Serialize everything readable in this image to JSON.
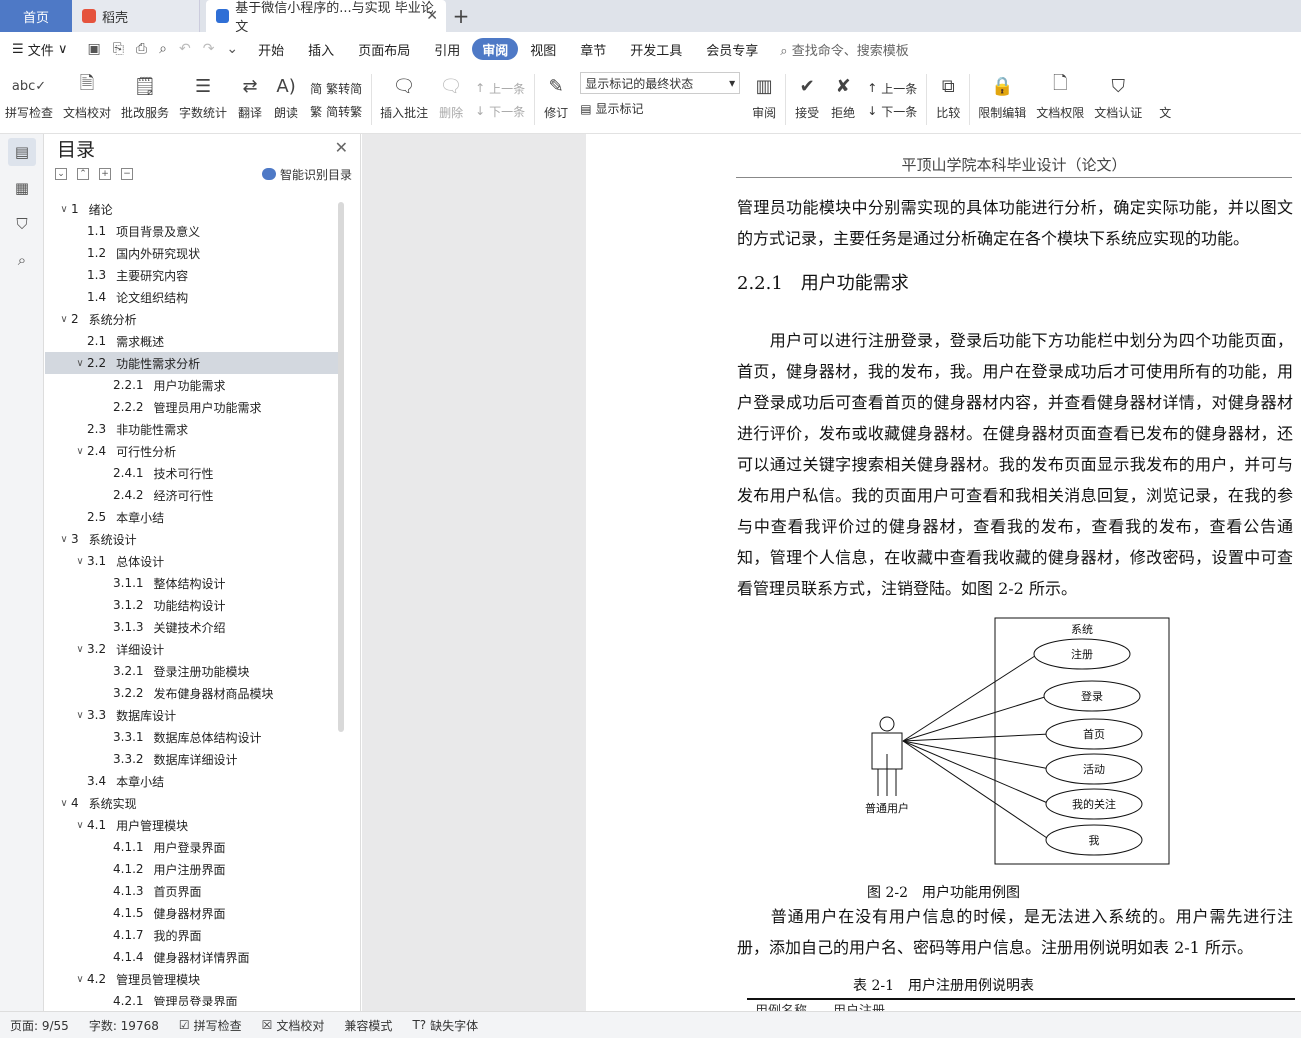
{
  "tabs": {
    "home": "首页",
    "daoke": "稻壳",
    "doc": "基于微信小程序的...与实现 毕业论文"
  },
  "menu": {
    "file": "文件",
    "items": [
      "开始",
      "插入",
      "页面布局",
      "引用",
      "审阅",
      "视图",
      "章节",
      "开发工具",
      "会员专享"
    ],
    "active": "审阅",
    "search": "查找命令、搜索模板"
  },
  "ribbon": {
    "spell": "拼写检查",
    "proof": "文档校对",
    "batch": "批改服务",
    "wordcount": "字数统计",
    "translate": "翻译",
    "read": "朗读",
    "trad": "繁转简",
    "simp": "简转繁",
    "insert_comment": "插入批注",
    "delete": "删除",
    "prev_comment": "上一条",
    "next_comment": "下一条",
    "revise": "修订",
    "markup_select": "显示标记的最终状态",
    "show_markup": "显示标记",
    "review": "审阅",
    "accept": "接受",
    "reject": "拒绝",
    "prev": "上一条",
    "next": "下一条",
    "compare": "比较",
    "restrict": "限制编辑",
    "permission": "文档权限",
    "certify": "文档认证",
    "more": "文"
  },
  "toc": {
    "title": "目录",
    "smart": "智能识别目录",
    "items": [
      {
        "level": 1,
        "num": "1",
        "text": "绪论",
        "chev": "∨"
      },
      {
        "level": 2,
        "num": "1.1",
        "text": "项目背景及意义",
        "chev": ""
      },
      {
        "level": 2,
        "num": "1.2",
        "text": "国内外研究现状",
        "chev": ""
      },
      {
        "level": 2,
        "num": "1.3",
        "text": "主要研究内容",
        "chev": ""
      },
      {
        "level": 2,
        "num": "1.4",
        "text": "论文组织结构",
        "chev": ""
      },
      {
        "level": 1,
        "num": "2",
        "text": "系统分析",
        "chev": "∨"
      },
      {
        "level": 2,
        "num": "2.1",
        "text": "需求概述",
        "chev": ""
      },
      {
        "level": 2,
        "num": "2.2",
        "text": "功能性需求分析",
        "chev": "∨",
        "sel": true
      },
      {
        "level": 3,
        "num": "2.2.1",
        "text": "用户功能需求",
        "chev": ""
      },
      {
        "level": 3,
        "num": "2.2.2",
        "text": "管理员用户功能需求",
        "chev": ""
      },
      {
        "level": 2,
        "num": "2.3",
        "text": "非功能性需求",
        "chev": ""
      },
      {
        "level": 2,
        "num": "2.4",
        "text": "可行性分析",
        "chev": "∨"
      },
      {
        "level": 3,
        "num": "2.4.1",
        "text": "技术可行性",
        "chev": ""
      },
      {
        "level": 3,
        "num": "2.4.2",
        "text": "经济可行性",
        "chev": ""
      },
      {
        "level": 2,
        "num": "2.5",
        "text": "本章小结",
        "chev": ""
      },
      {
        "level": 1,
        "num": "3",
        "text": "系统设计",
        "chev": "∨"
      },
      {
        "level": 2,
        "num": "3.1",
        "text": "总体设计",
        "chev": "∨"
      },
      {
        "level": 3,
        "num": "3.1.1",
        "text": "整体结构设计",
        "chev": ""
      },
      {
        "level": 3,
        "num": "3.1.2",
        "text": "功能结构设计",
        "chev": ""
      },
      {
        "level": 3,
        "num": "3.1.3",
        "text": "关键技术介绍",
        "chev": ""
      },
      {
        "level": 2,
        "num": "3.2",
        "text": "详细设计",
        "chev": "∨"
      },
      {
        "level": 3,
        "num": "3.2.1",
        "text": "登录注册功能模块",
        "chev": ""
      },
      {
        "level": 3,
        "num": "3.2.2",
        "text": "发布健身器材商品模块",
        "chev": ""
      },
      {
        "level": 2,
        "num": "3.3",
        "text": "数据库设计",
        "chev": "∨"
      },
      {
        "level": 3,
        "num": "3.3.1",
        "text": "数据库总体结构设计",
        "chev": ""
      },
      {
        "level": 3,
        "num": "3.3.2",
        "text": "数据库详细设计",
        "chev": ""
      },
      {
        "level": 2,
        "num": "3.4",
        "text": "本章小结",
        "chev": ""
      },
      {
        "level": 1,
        "num": "4",
        "text": "系统实现",
        "chev": "∨"
      },
      {
        "level": 2,
        "num": "4.1",
        "text": "用户管理模块",
        "chev": "∨"
      },
      {
        "level": 3,
        "num": "4.1.1",
        "text": "用户登录界面",
        "chev": ""
      },
      {
        "level": 3,
        "num": "4.1.2",
        "text": "用户注册界面",
        "chev": ""
      },
      {
        "level": 3,
        "num": "4.1.3",
        "text": "首页界面",
        "chev": ""
      },
      {
        "level": 3,
        "num": "4.1.5",
        "text": "健身器材界面",
        "chev": ""
      },
      {
        "level": 3,
        "num": "4.1.7",
        "text": "我的界面",
        "chev": ""
      },
      {
        "level": 3,
        "num": "4.1.4",
        "text": "健身器材详情界面",
        "chev": ""
      },
      {
        "level": 2,
        "num": "4.2",
        "text": "管理员管理模块",
        "chev": "∨"
      },
      {
        "level": 3,
        "num": "4.2.1",
        "text": "管理员登录界面",
        "chev": ""
      }
    ]
  },
  "page": {
    "header": "平顶山学院本科毕业设计（论文）",
    "para1": "管理员功能模块中分别需实现的具体功能进行分析，确定实际功能，并以图文的方式记录，主要任务是通过分析确定在各个模块下系统应实现的功能。",
    "heading": "2.2.1　用户功能需求",
    "para2": "　　用户可以进行注册登录，登录后功能下方功能栏中划分为四个功能页面，首页，健身器材，我的发布，我。用户在登录成功后才可使用所有的功能，用户登录成功后可查看首页的健身器材内容，并查看健身器材详情，对健身器材进行评价，发布或收藏健身器材。在健身器材页面查看已发布的健身器材，还可以通过关键字搜索相关健身器材。我的发布页面显示我发布的用户，并可与发布用户私信。我的页面用户可查看和我相关消息回复，浏览记录，在我的参与中查看我评价过的健身器材，查看我的发布，查看我的发布，查看公告通知，管理个人信息，在收藏中查看我收藏的健身器材，修改密码，设置中可查看管理员联系方式，注销登陆。如图 2-2 所示。",
    "diagram": {
      "system": "系统",
      "actor": "普通用户",
      "usecases": [
        "注册",
        "登录",
        "首页",
        "活动",
        "我的关注",
        "我"
      ]
    },
    "fig_caption": "图 2-2　用户功能用例图",
    "para3": "　　普通用户在没有用户信息的时候，是无法进入系统的。用户需先进行注册，添加自己的用户名、密码等用户信息。注册用例说明如表 2-1 所示。",
    "table_caption": "表 2-1　用户注册用例说明表",
    "table_cut": "用例名称　　用户注册"
  },
  "status": {
    "page": "页面: 9/55",
    "words": "字数: 19768",
    "spell": "拼写检查",
    "proof": "文档校对",
    "compat": "兼容模式",
    "font": "缺失字体"
  },
  "colors": {
    "accent": "#4e79c6",
    "tabbar": "#dfe3ea",
    "selected_toc": "#d3d8df"
  }
}
